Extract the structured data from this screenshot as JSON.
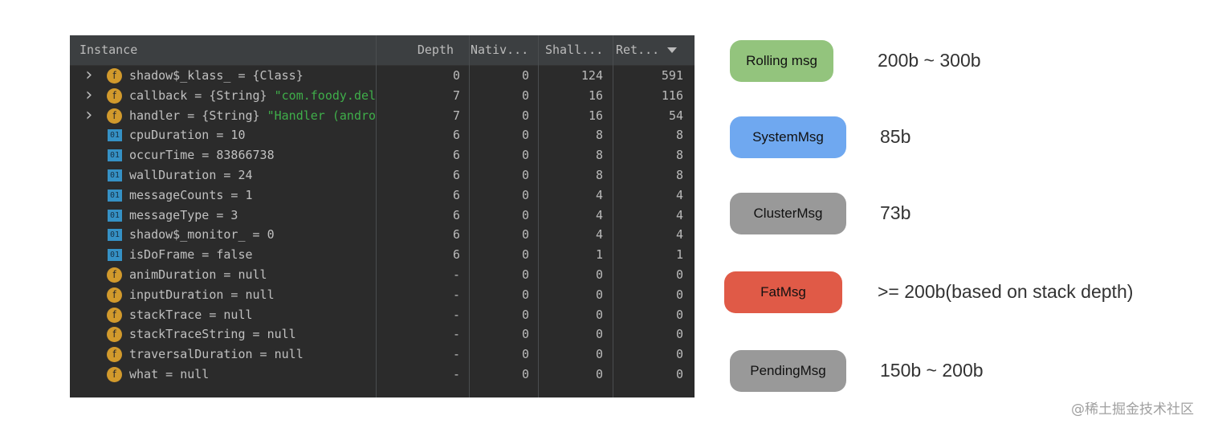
{
  "table": {
    "columns": {
      "instance": "Instance",
      "depth": "Depth",
      "native": "Nativ...",
      "shallow": "Shall...",
      "retained": "Ret..."
    },
    "sort_icon": "sort-descending-icon",
    "rows": [
      {
        "icon": "f",
        "expandable": true,
        "label": "shadow$_klass_ = {Class}",
        "value": "",
        "depth": "0",
        "native": "0",
        "shallow": "124",
        "retained": "591"
      },
      {
        "icon": "f",
        "expandable": true,
        "label": "callback = {String} ",
        "value": "\"com.foody.deli",
        "depth": "7",
        "native": "0",
        "shallow": "16",
        "retained": "116"
      },
      {
        "icon": "f",
        "expandable": true,
        "label": "handler = {String} ",
        "value": "\"Handler (android",
        "depth": "7",
        "native": "0",
        "shallow": "16",
        "retained": "54"
      },
      {
        "icon": "01",
        "expandable": false,
        "label": "cpuDuration = 10",
        "value": "",
        "depth": "6",
        "native": "0",
        "shallow": "8",
        "retained": "8"
      },
      {
        "icon": "01",
        "expandable": false,
        "label": "occurTime = 83866738",
        "value": "",
        "depth": "6",
        "native": "0",
        "shallow": "8",
        "retained": "8"
      },
      {
        "icon": "01",
        "expandable": false,
        "label": "wallDuration = 24",
        "value": "",
        "depth": "6",
        "native": "0",
        "shallow": "8",
        "retained": "8"
      },
      {
        "icon": "01",
        "expandable": false,
        "label": "messageCounts = 1",
        "value": "",
        "depth": "6",
        "native": "0",
        "shallow": "4",
        "retained": "4"
      },
      {
        "icon": "01",
        "expandable": false,
        "label": "messageType = 3",
        "value": "",
        "depth": "6",
        "native": "0",
        "shallow": "4",
        "retained": "4"
      },
      {
        "icon": "01",
        "expandable": false,
        "label": "shadow$_monitor_ = 0",
        "value": "",
        "depth": "6",
        "native": "0",
        "shallow": "4",
        "retained": "4"
      },
      {
        "icon": "01",
        "expandable": false,
        "label": "isDoFrame = false",
        "value": "",
        "depth": "6",
        "native": "0",
        "shallow": "1",
        "retained": "1"
      },
      {
        "icon": "f",
        "expandable": false,
        "label": "animDuration = null",
        "value": "",
        "depth": "-",
        "native": "0",
        "shallow": "0",
        "retained": "0"
      },
      {
        "icon": "f",
        "expandable": false,
        "label": "inputDuration = null",
        "value": "",
        "depth": "-",
        "native": "0",
        "shallow": "0",
        "retained": "0"
      },
      {
        "icon": "f",
        "expandable": false,
        "label": "stackTrace = null",
        "value": "",
        "depth": "-",
        "native": "0",
        "shallow": "0",
        "retained": "0"
      },
      {
        "icon": "f",
        "expandable": false,
        "label": "stackTraceString = null",
        "value": "",
        "depth": "-",
        "native": "0",
        "shallow": "0",
        "retained": "0"
      },
      {
        "icon": "f",
        "expandable": false,
        "label": "traversalDuration = null",
        "value": "",
        "depth": "-",
        "native": "0",
        "shallow": "0",
        "retained": "0"
      },
      {
        "icon": "f",
        "expandable": false,
        "label": "what = null",
        "value": "",
        "depth": "-",
        "native": "0",
        "shallow": "0",
        "retained": "0"
      }
    ]
  },
  "legend": [
    {
      "name": "Rolling msg",
      "size": "200b ~ 300b",
      "color": "#93c47d"
    },
    {
      "name": "SystemMsg",
      "size": "85b",
      "color": "#6fa8f0"
    },
    {
      "name": "ClusterMsg",
      "size": "73b",
      "color": "#999999"
    },
    {
      "name": "FatMsg",
      "size": ">= 200b(based on stack depth)",
      "color": "#e05a47"
    },
    {
      "name": "PendingMsg",
      "size": "150b ~ 200b",
      "color": "#999999"
    }
  ],
  "watermark": "@稀土掘金技术社区"
}
